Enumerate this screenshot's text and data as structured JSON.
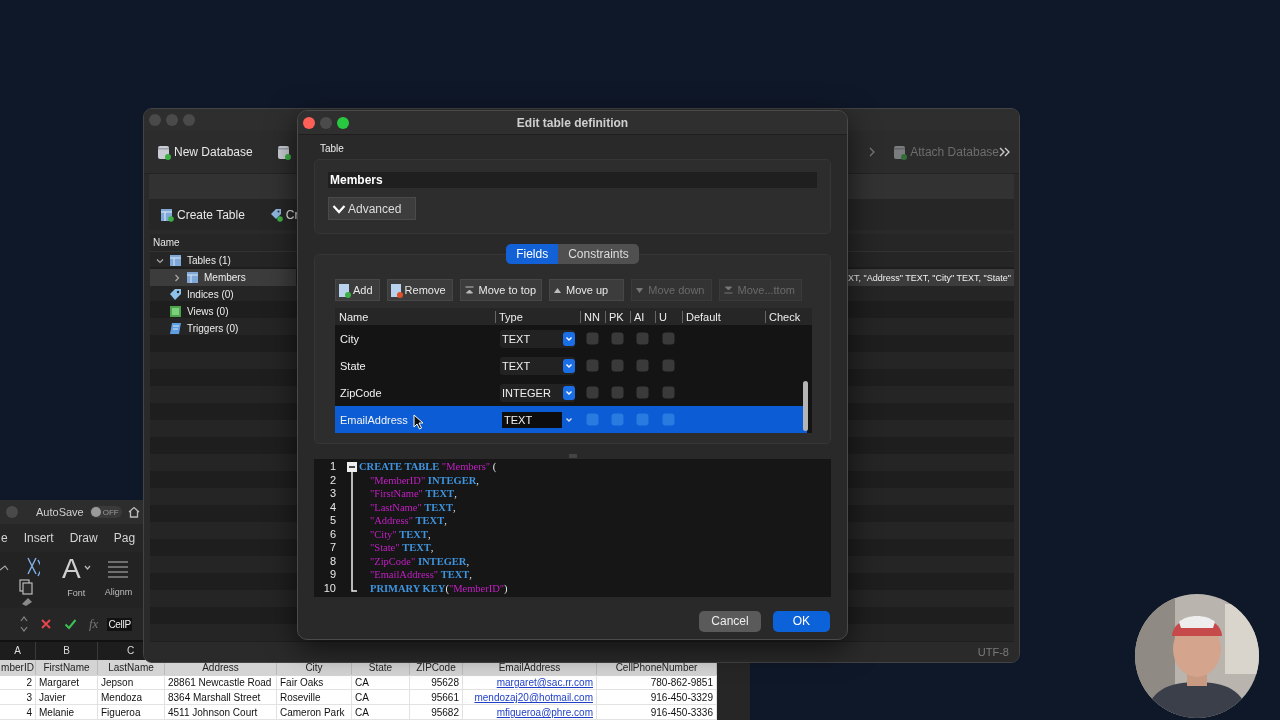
{
  "excel": {
    "autosave": {
      "label": "AutoSave",
      "state_text": "OFF",
      "on": false
    },
    "ribbon_tabs": [
      {
        "label": "e"
      },
      {
        "label": "Insert"
      },
      {
        "label": "Draw"
      },
      {
        "label": "Pag"
      }
    ],
    "font_group": {
      "glyph": "A",
      "label": "Font"
    },
    "alignment_group": {
      "label": "Alignm"
    },
    "formula_bar": {
      "function_label": "fx",
      "value": "CellP"
    },
    "column_letters": [
      "A",
      "B",
      "C"
    ],
    "sheet": {
      "columns": [
        {
          "label": "mberID",
          "kind": "number"
        },
        {
          "label": "FirstName",
          "kind": "text"
        },
        {
          "label": "LastName",
          "kind": "text"
        },
        {
          "label": "Address",
          "kind": "text"
        },
        {
          "label": "City",
          "kind": "text"
        },
        {
          "label": "State",
          "kind": "text"
        },
        {
          "label": "ZIPCode",
          "kind": "number"
        },
        {
          "label": "EmailAddress",
          "kind": "link"
        },
        {
          "label": "CellPhoneNumber",
          "kind": "number"
        }
      ],
      "rows": [
        [
          "2",
          "Margaret",
          "Jepson",
          "28861 Newcastle Road",
          "Fair Oaks",
          "CA",
          "95628",
          "margaret@sac.rr.com",
          "780-862-9851"
        ],
        [
          "3",
          "Javier",
          "Mendoza",
          "8364 Marshall Street",
          "Roseville",
          "CA",
          "95661",
          "mendozaj20@hotmail.com",
          "916-450-3329"
        ],
        [
          "4",
          "Melanie",
          "Figueroa",
          "4511 Johnson Court",
          "Cameron Park",
          "CA",
          "95682",
          "mfigueroa@phre.com",
          "916-450-3336"
        ]
      ]
    }
  },
  "main_window": {
    "toolbar": [
      {
        "label": "New Database",
        "disabled": false
      },
      {
        "label": "Attach Database",
        "disabled": true
      }
    ],
    "structure_toolbar": [
      {
        "label": "Create Table"
      },
      {
        "label": "Cr"
      }
    ],
    "tree": {
      "header": "Name",
      "items": [
        {
          "label": "Tables (1)",
          "kind": "table",
          "selected": false,
          "expanded": true,
          "children": [
            {
              "label": "Members",
              "kind": "table",
              "selected": true,
              "expanded": false,
              "schema": "XT, \"Address\" TEXT, \"City\" TEXT, \"State\""
            }
          ]
        },
        {
          "label": "Indices (0)",
          "kind": "index",
          "selected": false
        },
        {
          "label": "Views (0)",
          "kind": "view",
          "selected": false
        },
        {
          "label": "Triggers (0)",
          "kind": "trigger",
          "selected": false
        }
      ]
    },
    "status": "UTF-8"
  },
  "dialog": {
    "title": "Edit table definition",
    "table_label": "Table",
    "table_name": "Members",
    "advanced_label": "Advanced",
    "tabs": [
      {
        "label": "Fields",
        "selected": true
      },
      {
        "label": "Constraints",
        "selected": false
      }
    ],
    "field_buttons": [
      {
        "label": "Add",
        "kind": "add",
        "disabled": false
      },
      {
        "label": "Remove",
        "kind": "remove",
        "disabled": false
      },
      {
        "label": "Move to top",
        "kind": "top",
        "disabled": false
      },
      {
        "label": "Move up",
        "kind": "up",
        "disabled": false
      },
      {
        "label": "Move down",
        "kind": "down",
        "disabled": true
      },
      {
        "label": "Move...ttom",
        "kind": "bottom",
        "disabled": true
      }
    ],
    "columns": [
      "Name",
      "Type",
      "NN",
      "PK",
      "AI",
      "U",
      "Default",
      "Check"
    ],
    "fields": [
      {
        "name": "City",
        "type": "TEXT",
        "nn": false,
        "pk": false,
        "ai": false,
        "u": false,
        "selected": false
      },
      {
        "name": "State",
        "type": "TEXT",
        "nn": false,
        "pk": false,
        "ai": false,
        "u": false,
        "selected": false
      },
      {
        "name": "ZipCode",
        "type": "INTEGER",
        "nn": false,
        "pk": false,
        "ai": false,
        "u": false,
        "selected": false
      },
      {
        "name": "EmailAddress",
        "type": "TEXT",
        "nn": false,
        "pk": false,
        "ai": false,
        "u": false,
        "selected": true
      }
    ],
    "sql_lines": [
      {
        "number": "1",
        "indent": false,
        "tokens": [
          {
            "kind": "keyword",
            "text": "CREATE TABLE"
          },
          {
            "kind": "name",
            "text": "\"Members\""
          },
          {
            "kind": "punct",
            "text": "("
          }
        ]
      },
      {
        "number": "2",
        "indent": true,
        "tokens": [
          {
            "kind": "name",
            "text": "\"MemberID\""
          },
          {
            "kind": "keyword",
            "text": "INTEGER"
          },
          {
            "kind": "punct",
            "text": ",",
            "tight": true
          }
        ]
      },
      {
        "number": "3",
        "indent": true,
        "tokens": [
          {
            "kind": "name",
            "text": "\"FirstName\""
          },
          {
            "kind": "keyword",
            "text": "TEXT"
          },
          {
            "kind": "punct",
            "text": ",",
            "tight": true
          }
        ]
      },
      {
        "number": "4",
        "indent": true,
        "tokens": [
          {
            "kind": "name",
            "text": "\"LastName\""
          },
          {
            "kind": "keyword",
            "text": "TEXT"
          },
          {
            "kind": "punct",
            "text": ",",
            "tight": true
          }
        ]
      },
      {
        "number": "5",
        "indent": true,
        "tokens": [
          {
            "kind": "name",
            "text": "\"Address\""
          },
          {
            "kind": "keyword",
            "text": "TEXT"
          },
          {
            "kind": "punct",
            "text": ",",
            "tight": true
          }
        ]
      },
      {
        "number": "6",
        "indent": true,
        "tokens": [
          {
            "kind": "name",
            "text": "\"City\""
          },
          {
            "kind": "keyword",
            "text": "TEXT"
          },
          {
            "kind": "punct",
            "text": ",",
            "tight": true
          }
        ]
      },
      {
        "number": "7",
        "indent": true,
        "tokens": [
          {
            "kind": "name",
            "text": "\"State\""
          },
          {
            "kind": "keyword",
            "text": "TEXT"
          },
          {
            "kind": "punct",
            "text": ",",
            "tight": true
          }
        ]
      },
      {
        "number": "8",
        "indent": true,
        "tokens": [
          {
            "kind": "name",
            "text": "\"ZipCode\""
          },
          {
            "kind": "keyword",
            "text": "INTEGER"
          },
          {
            "kind": "punct",
            "text": ",",
            "tight": true
          }
        ]
      },
      {
        "number": "9",
        "indent": true,
        "tokens": [
          {
            "kind": "name",
            "text": "\"EmailAddress\""
          },
          {
            "kind": "keyword",
            "text": "TEXT"
          },
          {
            "kind": "punct",
            "text": ",",
            "tight": true
          }
        ]
      },
      {
        "number": "10",
        "indent": true,
        "tokens": [
          {
            "kind": "keyword",
            "text": "PRIMARY KEY"
          },
          {
            "kind": "punct",
            "text": "(",
            "tight": true
          },
          {
            "kind": "name",
            "text": "\"MemberID\"",
            "tight": true
          },
          {
            "kind": "punct",
            "text": ")",
            "tight": true
          }
        ]
      }
    ],
    "buttons": [
      {
        "label": "Cancel",
        "default": false
      },
      {
        "label": "OK",
        "default": true
      }
    ]
  }
}
